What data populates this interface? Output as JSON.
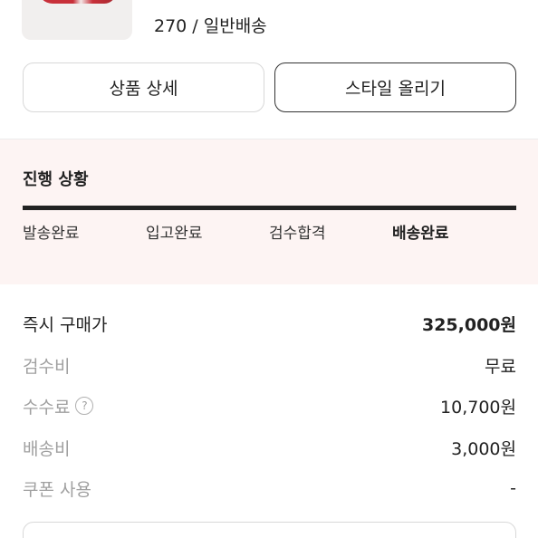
{
  "product": {
    "size_shipping": "270 / 일반배송"
  },
  "buttons": {
    "product_detail": "상품 상세",
    "post_style": "스타일 올리기"
  },
  "progress": {
    "title": "진행 상황",
    "steps": [
      "발송완료",
      "입고완료",
      "검수합격",
      "배송완료"
    ],
    "active_step": "배송완료"
  },
  "pricing": {
    "instant_buy_label": "즉시 구매가",
    "instant_buy_value": "325,000원",
    "inspection_label": "검수비",
    "inspection_value": "무료",
    "fee_label": "수수료",
    "fee_help": "?",
    "fee_value": "10,700원",
    "shipping_label": "배송비",
    "shipping_value": "3,000원",
    "coupon_label": "쿠폰 사용",
    "coupon_value": "-"
  },
  "colors": {
    "progress_bg": "#fdf4f3",
    "accent_dark": "#222222",
    "muted_text": "#a0a0a0"
  }
}
